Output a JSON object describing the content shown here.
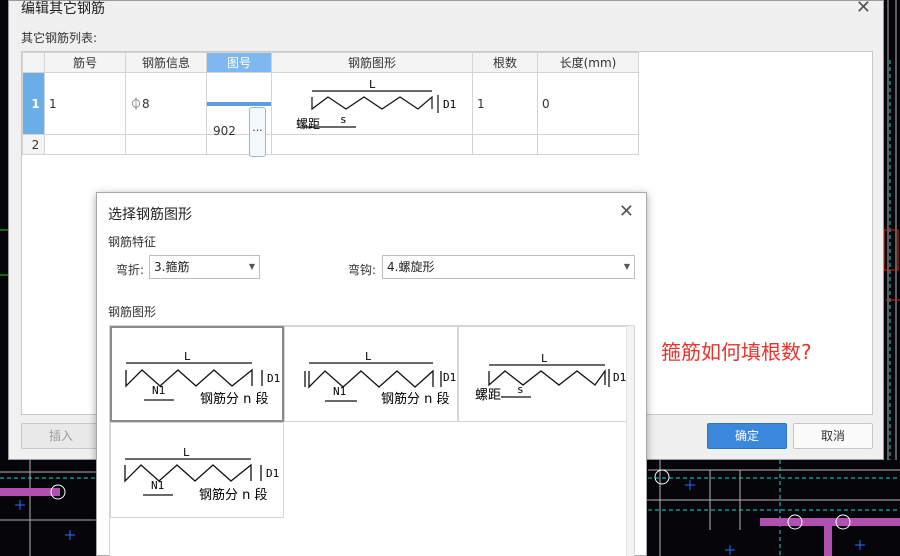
{
  "main_dialog": {
    "title": "编辑其它钢筋",
    "list_label": "其它钢筋列表:",
    "columns": [
      "筋号",
      "钢筋信息",
      "图号",
      "钢筋图形",
      "根数",
      "长度(mm)"
    ],
    "rows": [
      {
        "row_no": "1",
        "bar_no": "1",
        "info": "⏀8",
        "shape_no": "902",
        "count": "1",
        "length": "0"
      },
      {
        "row_no": "2",
        "bar_no": "",
        "info": "",
        "shape_no": "",
        "count": "",
        "length": ""
      }
    ],
    "ellipsis_label": "···",
    "insert_label": "插入",
    "ok_label": "确定",
    "cancel_label": "取消"
  },
  "annotation": "箍筋如何填根数?",
  "modal": {
    "title": "选择钢筋图形",
    "feature_section": "钢筋特征",
    "bend_label": "弯折:",
    "bend_value": "3.箍筋",
    "hook_label": "弯钩:",
    "hook_value": "4.螺旋形",
    "shape_section": "钢筋图形"
  },
  "shape_labels": {
    "L": "L",
    "D1": "D1",
    "N1": "N1",
    "segments": "钢筋分 n 段",
    "pitch": "螺距",
    "s": "s"
  },
  "colors": {
    "primary": "#3b87dc",
    "annotation": "#e8332c",
    "selected_header": "#7fb8ef"
  }
}
